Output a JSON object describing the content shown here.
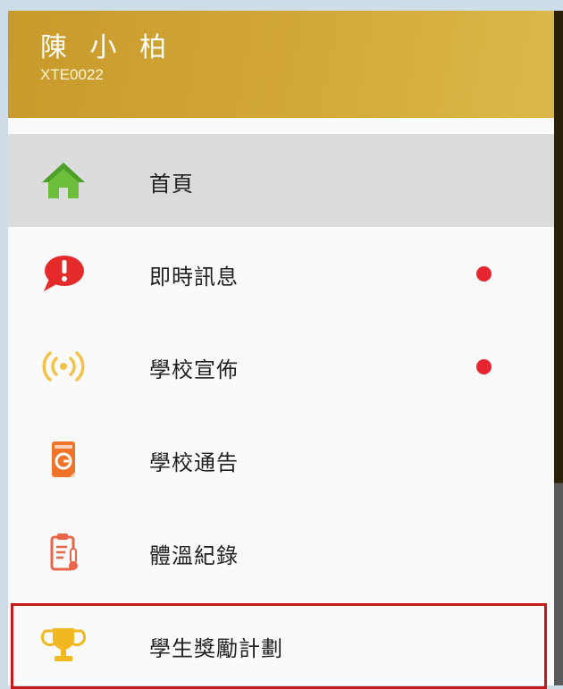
{
  "header": {
    "user_name": "陳 小 柏",
    "user_id": "XTE0022"
  },
  "menu": {
    "items": [
      {
        "label": "首頁",
        "icon": "home-icon",
        "badge": false,
        "active": true
      },
      {
        "label": "即時訊息",
        "icon": "alert-speech-bubble-icon",
        "badge": true,
        "active": false
      },
      {
        "label": "學校宣佈",
        "icon": "broadcast-icon",
        "badge": true,
        "active": false
      },
      {
        "label": "學校通告",
        "icon": "notice-book-icon",
        "badge": false,
        "active": false
      },
      {
        "label": "體溫紀錄",
        "icon": "clipboard-thermometer-icon",
        "badge": false,
        "active": false
      },
      {
        "label": "學生獎勵計劃",
        "icon": "trophy-icon",
        "badge": false,
        "active": false
      }
    ]
  },
  "colors": {
    "header_gold": "#d3a83a",
    "badge_red": "#e5262f",
    "highlight_red": "#c21a1a",
    "home_green": "#6cbf3a",
    "icon_orange": "#f0732a",
    "icon_yellow": "#f2b81f"
  }
}
